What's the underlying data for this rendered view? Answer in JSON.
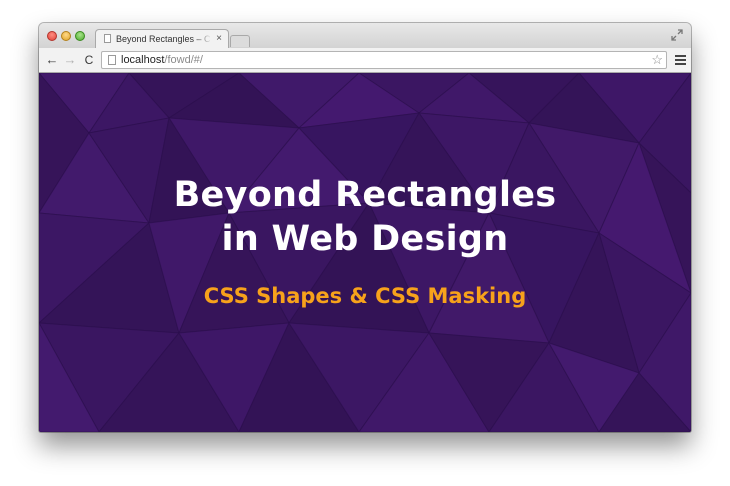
{
  "browser": {
    "tab": {
      "title": "Beyond Rectangles – CSS Shapes & CSS Masking",
      "close_glyph": "×"
    },
    "toolbar": {
      "back_glyph": "←",
      "forward_glyph": "→",
      "reload_glyph": "C",
      "url_host": "localhost",
      "url_path": "/fowd/#/",
      "star_glyph": "☆"
    },
    "icons": {
      "close": "close-window-icon",
      "minimize": "minimize-window-icon",
      "maximize": "maximize-window-icon",
      "page": "page-icon",
      "fullscreen": "fullscreen-icon",
      "bookmark": "star-icon",
      "menu": "hamburger-menu-icon"
    }
  },
  "slide": {
    "title_line1": "Beyond Rectangles",
    "title_line2": "in Web Design",
    "subtitle": "CSS Shapes & CSS Masking"
  },
  "colors": {
    "slide_background": "#3a1660",
    "title_text": "#ffffff",
    "subtitle_text": "#f7a21b"
  }
}
